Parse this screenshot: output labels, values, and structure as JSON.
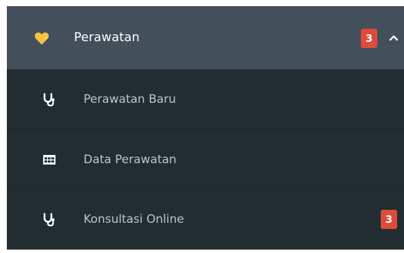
{
  "menu": {
    "label": "Perawatan",
    "badge": "3",
    "heart_color": "#f5c342",
    "header_bg": "#434f5a",
    "items": [
      {
        "label": "Perawatan Baru",
        "icon": "stethoscope-icon"
      },
      {
        "label": "Data Perawatan",
        "icon": "table-icon"
      },
      {
        "label": "Konsultasi Online",
        "icon": "stethoscope-icon",
        "badge": "3"
      }
    ]
  },
  "colors": {
    "sidebar_bg": "#222d32",
    "badge_bg": "#dd4b39",
    "submenu_text": "#b8c7ce"
  }
}
